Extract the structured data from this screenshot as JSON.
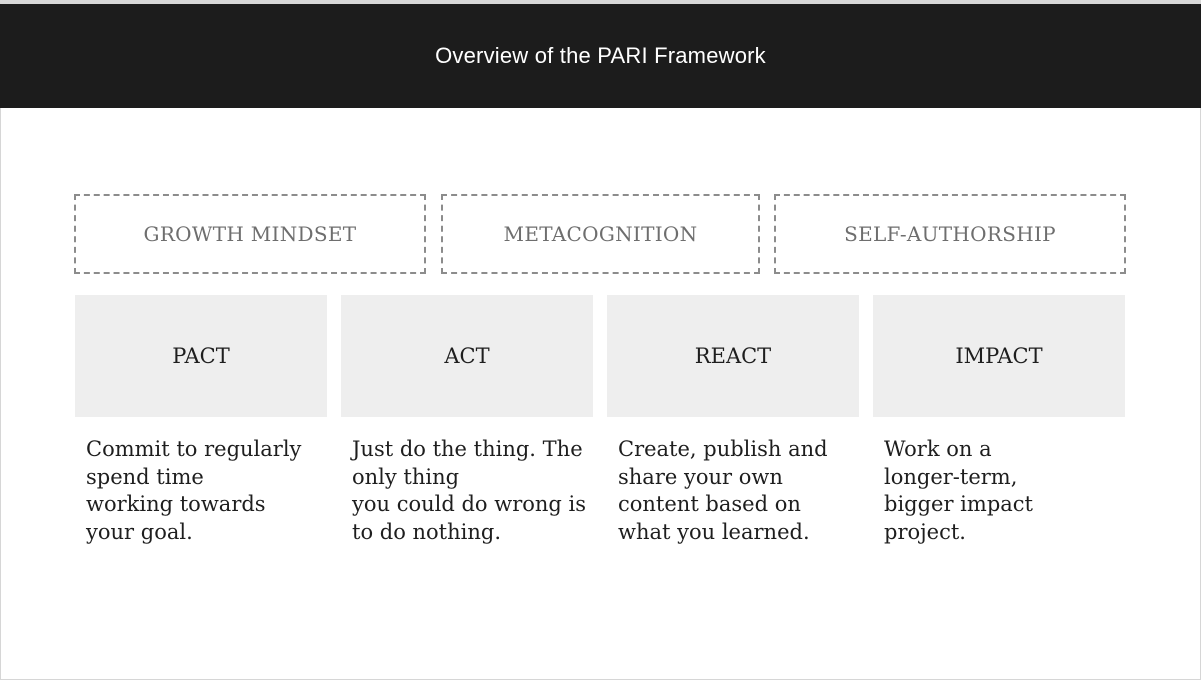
{
  "header": {
    "title": "Overview of the PARI Framework"
  },
  "mindsets": [
    {
      "label": "GROWTH MINDSET"
    },
    {
      "label": "METACOGNITION"
    },
    {
      "label": "SELF-AUTHORSHIP"
    }
  ],
  "stages": [
    {
      "label": "PACT",
      "description": "Commit to regularly\nspend time\nworking towards\nyour goal."
    },
    {
      "label": "ACT",
      "description": "Just do the thing. The\nonly thing\nyou could do wrong is\nto do nothing."
    },
    {
      "label": "REACT",
      "description": "Create, publish and\nshare your own\ncontent based on\nwhat you learned."
    },
    {
      "label": "IMPACT",
      "description": "Work on a\nlonger-term,\nbigger impact\nproject."
    }
  ],
  "colors": {
    "header_background": "#1c1c1c",
    "stage_fill": "#eeeeee",
    "dashed_border": "#8c8c8c"
  }
}
